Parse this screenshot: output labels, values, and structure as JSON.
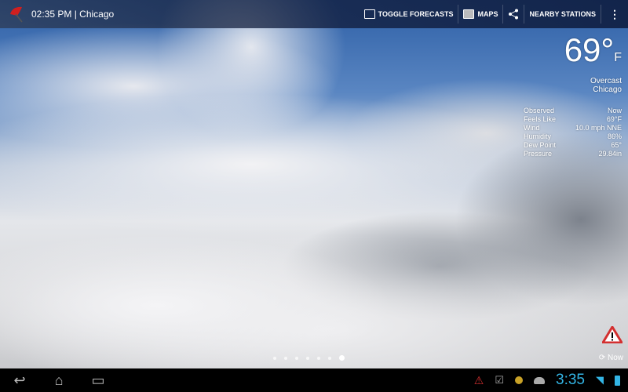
{
  "actionbar": {
    "title": "02:35 PM | Chicago",
    "toggle": "TOGGLE FORECASTS",
    "maps": "MAPS",
    "nearby": "NEARBY STATIONS"
  },
  "weather": {
    "temp": "69°",
    "unit": "F",
    "condition": "Overcast",
    "location": "Chicago",
    "details": [
      {
        "label": "Observed",
        "value": "Now"
      },
      {
        "label": "Feels Like",
        "value": "69°F"
      },
      {
        "label": "Wind",
        "value": "10.0 mph NNE"
      },
      {
        "label": "Humidity",
        "value": "86%"
      },
      {
        "label": "Dew Point",
        "value": "65°"
      },
      {
        "label": "Pressure",
        "value": "29.84in"
      }
    ]
  },
  "pager": {
    "count": 7,
    "active": 7
  },
  "refresh": "Now",
  "status": {
    "time": "3:35"
  },
  "colors": {
    "accent": "#33b5e5",
    "alert": "#d32f2f"
  }
}
